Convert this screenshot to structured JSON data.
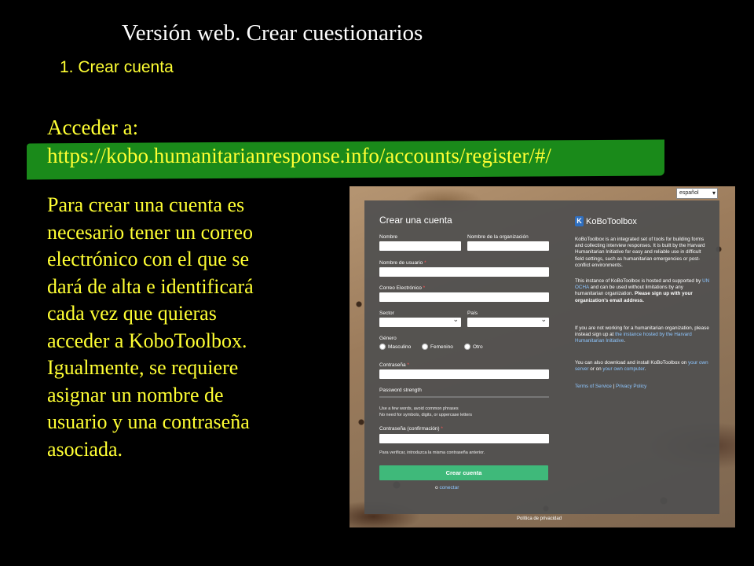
{
  "slide": {
    "title": "Versión web. Crear cuestionarios",
    "subtitle": "1. Crear cuenta",
    "access_label": "Acceder a:",
    "url": "https://kobo.humanitarianresponse.info/accounts/register/#/",
    "paragraph_lines": [
      "Para crear una cuenta es",
      "necesario tener un correo",
      "electrónico con el que se",
      "dará de alta e identificará",
      "cada vez que quieras",
      "acceder a KoboToolbox.",
      "Igualmente, se requiere",
      "asignar un nombre de",
      "usuario y una contraseña",
      "asociada."
    ],
    "colors": {
      "background": "#000000",
      "text": "#ffff33",
      "url_band": "#1a8a1a"
    }
  },
  "screenshot": {
    "language": "español",
    "form": {
      "title": "Crear una cuenta",
      "name_label": "Nombre",
      "org_label": "Nombre de la organización",
      "username_label": "Nombre de usuario",
      "email_label": "Correo Electrónico",
      "sector_label": "Sector",
      "country_label": "País",
      "gender_label": "Género",
      "gender_options": [
        "Masculino",
        "Femenino",
        "Otro"
      ],
      "password_label": "Contraseña",
      "password_strength_label": "Password strength",
      "password_hint_1": "Use a few words, avoid common phrases",
      "password_hint_2": "No need for symbols, digits, or uppercase letters",
      "password_confirm_label": "Contraseña (confirmación)",
      "password_confirm_hint": "Para verificar, introduzca la misma contraseña anterior.",
      "submit_label": "Crear cuenta",
      "login_prefix": "o",
      "login_link": "conectar",
      "required_mark": "*"
    },
    "info": {
      "logo_text": "KoBoToolbox",
      "p1": "KoBoToolbox is an integrated set of tools for building forms and collecting interview responses. It is built by the Harvard Humanitarian Initiative for easy and reliable use in difficult field settings, such as humanitarian emergencies or post-conflict environments.",
      "p2_a": "This instance of KoBoToolbox is hosted and supported by ",
      "p2_link": "UN OCHA",
      "p2_b": " and can be used without limitations by any humanitarian organization. ",
      "p2_bold": "Please sign up with your organization's email address.",
      "p3_a": "If you are not working for a humanitarian organization, please instead sign up at ",
      "p3_link": "the instance hosted by the Harvard Humanitarian Initiative",
      "p3_b": ".",
      "p4_a": "You can also download and install KoBoToolbox on ",
      "p4_link1": "your own server",
      "p4_mid": " or on ",
      "p4_link2": "your own computer",
      "p4_b": ".",
      "terms": "Terms of Service",
      "sep": " | ",
      "privacy_policy": "Privacy Policy"
    },
    "footer_privacy": "Política de privacidad"
  }
}
